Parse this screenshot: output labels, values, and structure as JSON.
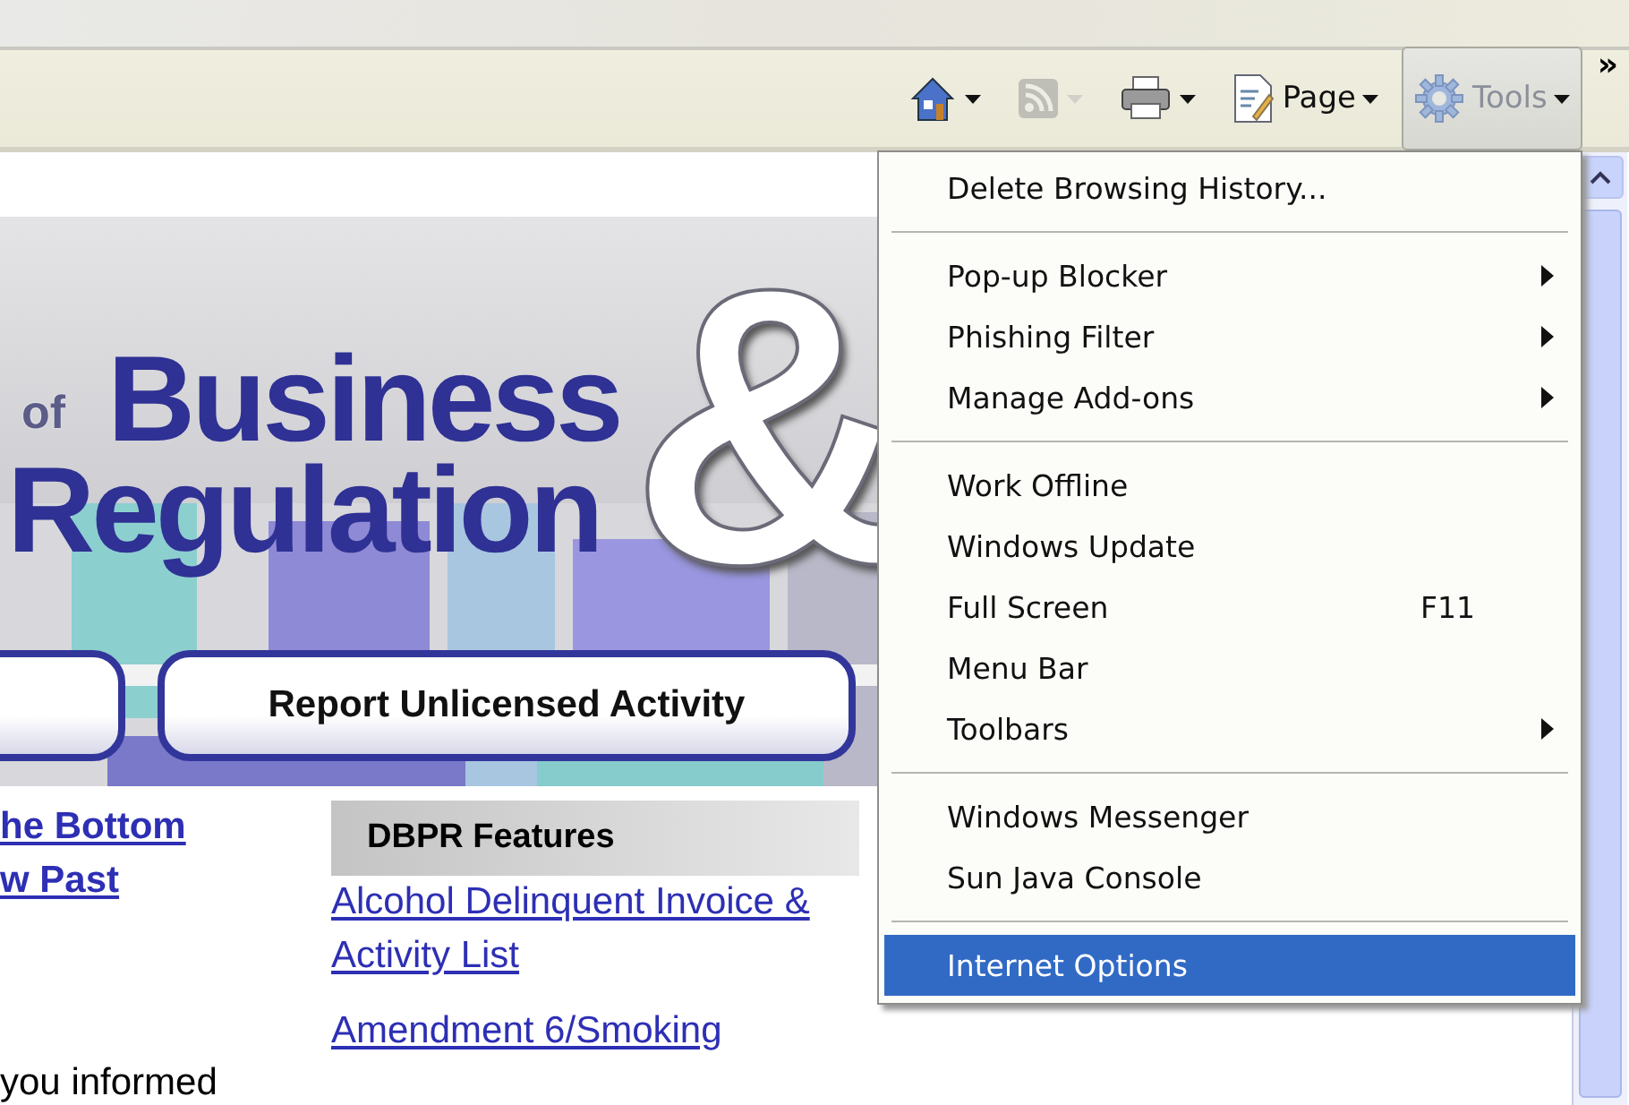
{
  "toolbar": {
    "items": [
      {
        "kind": "home",
        "dropdown": true,
        "disabled": false,
        "pressed": false
      },
      {
        "kind": "feeds",
        "dropdown": true,
        "disabled": true,
        "pressed": false
      },
      {
        "kind": "print",
        "dropdown": true,
        "disabled": false,
        "pressed": false
      },
      {
        "kind": "page",
        "label": "Page",
        "dropdown": true,
        "disabled": false,
        "pressed": false
      },
      {
        "kind": "tools",
        "label": "Tools",
        "dropdown": true,
        "disabled": false,
        "pressed": true
      }
    ],
    "overflow": "»"
  },
  "banner": {
    "logo_small": "of",
    "logo_line1": "Business",
    "logo_line2": "Regulation",
    "logo_mark": "&",
    "buttons": [
      "Report Unlicensed Activity"
    ]
  },
  "left_column": {
    "links": [
      "he Bottom",
      "w Past"
    ],
    "text": "you informed"
  },
  "features": {
    "heading": "DBPR Features",
    "links": [
      "Alcohol Delinquent Invoice & Activity List",
      "Amendment 6/Smoking"
    ]
  },
  "menu": {
    "sections": [
      [
        {
          "label": "Delete Browsing History...",
          "submenu": false,
          "selected": false
        }
      ],
      [
        {
          "label": "Pop-up Blocker",
          "submenu": true,
          "selected": false
        },
        {
          "label": "Phishing Filter",
          "submenu": true,
          "selected": false
        },
        {
          "label": "Manage Add-ons",
          "submenu": true,
          "selected": false
        }
      ],
      [
        {
          "label": "Work Offline",
          "submenu": false,
          "selected": false
        },
        {
          "label": "Windows Update",
          "submenu": false,
          "selected": false
        },
        {
          "label": "Full Screen",
          "shortcut": "F11",
          "submenu": false,
          "selected": false
        },
        {
          "label": "Menu Bar",
          "submenu": false,
          "selected": false
        },
        {
          "label": "Toolbars",
          "submenu": true,
          "selected": false
        }
      ],
      [
        {
          "label": "Windows Messenger",
          "submenu": false,
          "selected": false
        },
        {
          "label": "Sun Java Console",
          "submenu": false,
          "selected": false
        }
      ],
      [
        {
          "label": "Internet Options",
          "submenu": false,
          "selected": true
        }
      ]
    ]
  }
}
